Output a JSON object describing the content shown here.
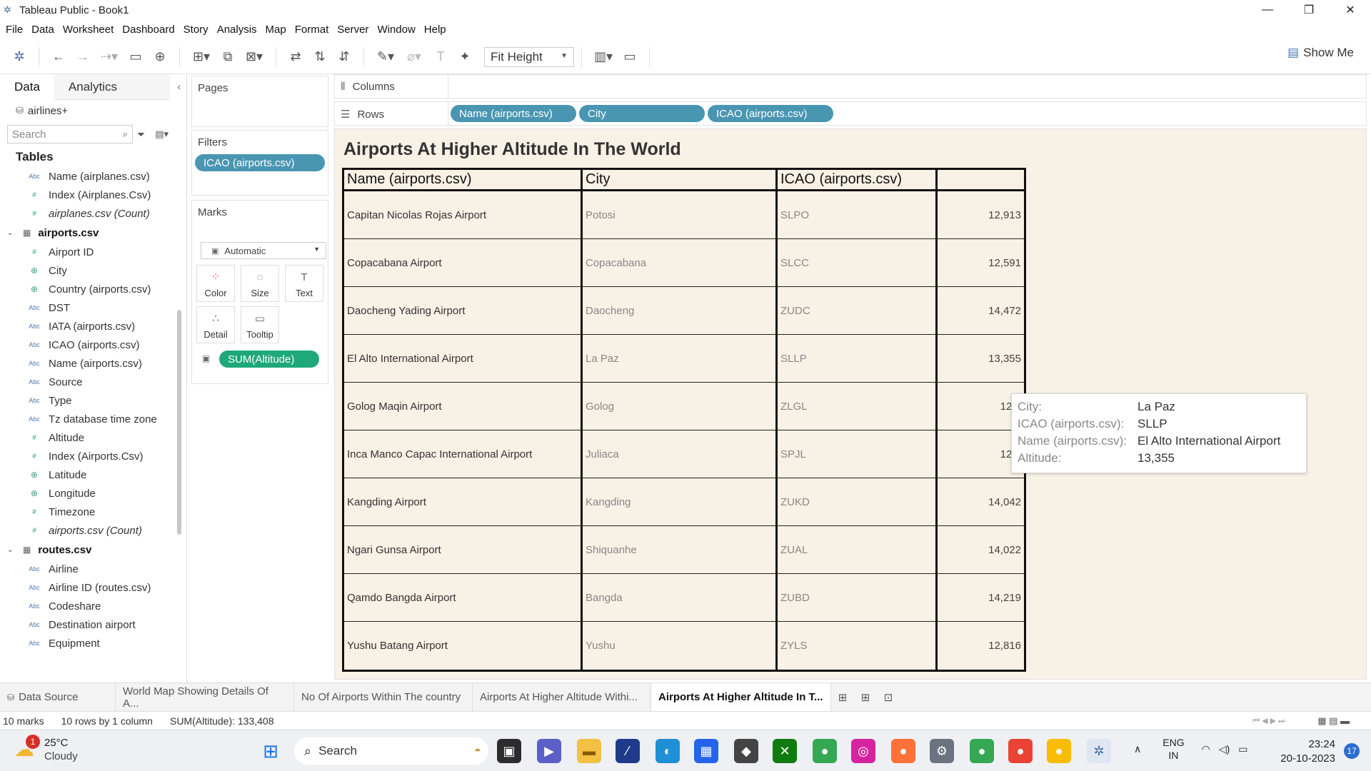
{
  "window": {
    "title": "Tableau Public - Book1",
    "controls": [
      "—",
      "❐",
      "✕"
    ]
  },
  "menu": [
    "File",
    "Data",
    "Worksheet",
    "Dashboard",
    "Story",
    "Analysis",
    "Map",
    "Format",
    "Server",
    "Window",
    "Help"
  ],
  "toolbar": {
    "fit": "Fit Height",
    "show_me": "Show Me"
  },
  "left": {
    "tab_data": "Data",
    "tab_analytics": "Analytics",
    "source": "airlines+",
    "search_placeholder": "Search",
    "tables_header": "Tables",
    "airplanes_fields": [
      {
        "type": "abc",
        "name": "Name (airplanes.csv)",
        "italic": false
      },
      {
        "type": "num",
        "name": "Index (Airplanes.Csv)",
        "italic": false
      },
      {
        "type": "num",
        "name": "airplanes.csv (Count)",
        "italic": true
      }
    ],
    "airports_group": "airports.csv",
    "airports_fields": [
      {
        "type": "num",
        "name": "Airport ID",
        "italic": false
      },
      {
        "type": "globe",
        "name": "City",
        "italic": false
      },
      {
        "type": "globe",
        "name": "Country (airports.csv)",
        "italic": false
      },
      {
        "type": "abc",
        "name": "DST",
        "italic": false
      },
      {
        "type": "abc",
        "name": "IATA (airports.csv)",
        "italic": false
      },
      {
        "type": "abc",
        "name": "ICAO (airports.csv)",
        "italic": false
      },
      {
        "type": "abc",
        "name": "Name (airports.csv)",
        "italic": false
      },
      {
        "type": "abc",
        "name": "Source",
        "italic": false
      },
      {
        "type": "abc",
        "name": "Type",
        "italic": false
      },
      {
        "type": "abc",
        "name": "Tz database time zone",
        "italic": false
      },
      {
        "type": "num",
        "name": "Altitude",
        "italic": false
      },
      {
        "type": "num",
        "name": "Index (Airports.Csv)",
        "italic": false
      },
      {
        "type": "globe",
        "name": "Latitude",
        "italic": false
      },
      {
        "type": "globe",
        "name": "Longitude",
        "italic": false
      },
      {
        "type": "num",
        "name": "Timezone",
        "italic": false
      },
      {
        "type": "num",
        "name": "airports.csv (Count)",
        "italic": true
      }
    ],
    "routes_group": "routes.csv",
    "routes_fields": [
      {
        "type": "abc",
        "name": "Airline",
        "italic": false
      },
      {
        "type": "abc",
        "name": "Airline ID (routes.csv)",
        "italic": false
      },
      {
        "type": "abc",
        "name": "Codeshare",
        "italic": false
      },
      {
        "type": "abc",
        "name": "Destination airport",
        "italic": false
      },
      {
        "type": "abc",
        "name": "Equipment",
        "italic": false
      }
    ]
  },
  "shelves": {
    "pages": "Pages",
    "filters": "Filters",
    "filter_pill": "ICAO (airports.csv)",
    "marks": "Marks",
    "mark_type": "Automatic",
    "mark_buttons": [
      "Color",
      "Size",
      "Text",
      "Detail",
      "Tooltip"
    ],
    "measure_pill": "SUM(Altitude)",
    "columns": "Columns",
    "rows": "Rows",
    "row_pills": [
      "Name (airports.csv)",
      "City",
      "ICAO (airports.csv)"
    ]
  },
  "sheet": {
    "title": "Airports At Higher Altitude In The World",
    "headers": [
      "Name (airports.csv)",
      "City",
      "ICAO (airports.csv)",
      ""
    ],
    "rows": [
      [
        "Capitan Nicolas Rojas Airport",
        "Potosi",
        "SLPO",
        "12,913"
      ],
      [
        "Copacabana Airport",
        "Copacabana",
        "SLCC",
        "12,591"
      ],
      [
        "Daocheng Yading Airport",
        "Daocheng",
        "ZUDC",
        "14,472"
      ],
      [
        "El Alto International Airport",
        "La Paz",
        "SLLP",
        "13,355"
      ],
      [
        "Golog Maqin Airport",
        "Golog",
        "ZLGL",
        "12,4"
      ],
      [
        "Inca Manco Capac International Airport",
        "Juliaca",
        "SPJL",
        "12,5"
      ],
      [
        "Kangding Airport",
        "Kangding",
        "ZUKD",
        "14,042"
      ],
      [
        "Ngari Gunsa Airport",
        "Shiquanhe",
        "ZUAL",
        "14,022"
      ],
      [
        "Qamdo Bangda Airport",
        "Bangda",
        "ZUBD",
        "14,219"
      ],
      [
        "Yushu Batang Airport",
        "Yushu",
        "ZYLS",
        "12,816"
      ]
    ]
  },
  "tooltip": [
    {
      "k": "City:",
      "v": "La Paz"
    },
    {
      "k": "ICAO (airports.csv):",
      "v": "SLLP"
    },
    {
      "k": "Name (airports.csv):",
      "v": "El Alto International Airport"
    },
    {
      "k": "Altitude:",
      "v": "13,355"
    }
  ],
  "sheet_tabs": [
    "Data Source",
    "World Map Showing Details Of A...",
    "No Of Airports Within The country",
    "Airports At Higher Altitude Withi...",
    "Airports At Higher Altitude In T..."
  ],
  "status": {
    "marks": "10 marks",
    "dims": "10 rows by 1 column",
    "sum": "SUM(Altitude): 133,408"
  },
  "taskbar": {
    "weather_temp": "25°C",
    "weather_desc": "Cloudy",
    "weather_badge": "1",
    "search": "Search",
    "lang1": "ENG",
    "lang2": "IN",
    "time": "23:24",
    "date": "20-10-2023",
    "notifications": "17"
  }
}
